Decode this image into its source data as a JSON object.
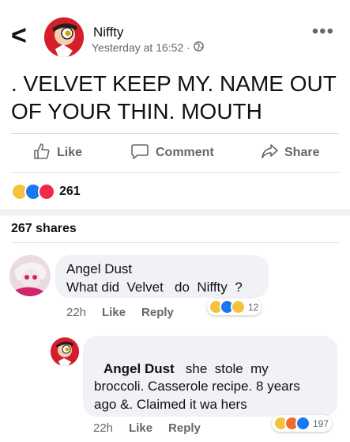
{
  "header": {
    "back_glyph": "<",
    "author": "Niffty",
    "timestamp": "Yesterday at 16:52 ·",
    "more_glyph": "•••",
    "icons": {
      "back": "back-arrow-icon",
      "globe": "globe-icon",
      "more": "more-options-icon"
    }
  },
  "post": {
    "text": ". VELVET KEEP MY. NAME OUT OF YOUR THIN. MOUTH"
  },
  "actions": {
    "like": "Like",
    "comment": "Comment",
    "share": "Share"
  },
  "reactions": {
    "types": [
      "haha",
      "like",
      "love"
    ],
    "count": "261"
  },
  "shares": "267 shares",
  "comments": [
    {
      "author": "Angel Dust",
      "text": "What did  Velvet   do  Niffty  ?",
      "time": "22h",
      "like": "Like",
      "reply": "Reply",
      "reactions": [
        "haha",
        "like",
        "wow"
      ],
      "reaction_count": "12"
    },
    {
      "author": "Angel Dust",
      "text_lines": [
        "she  stole  my",
        "broccoli. Casserole recipe. 8 years",
        "ago &. Claimed it wa hers"
      ],
      "time": "22h",
      "like": "Like",
      "reply": "Reply",
      "reactions": [
        "haha",
        "angry",
        "like"
      ],
      "reaction_count": "197"
    }
  ],
  "colors": {
    "accent": "#1877f2",
    "muted": "#65676b",
    "bubble": "#f0f2f5",
    "avatar_red": "#d41f2a"
  }
}
